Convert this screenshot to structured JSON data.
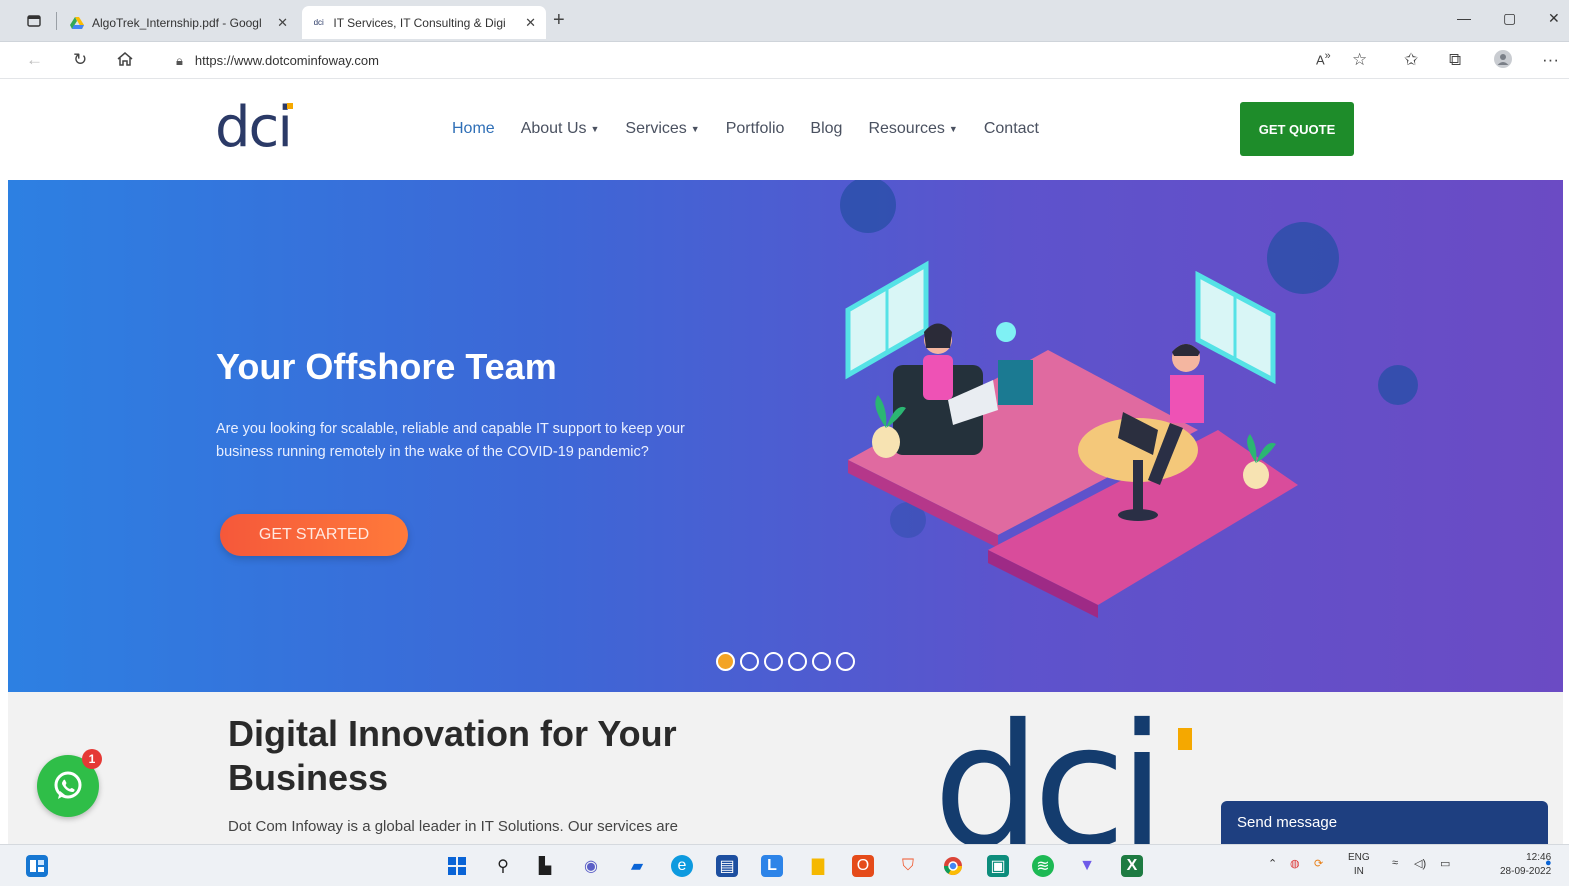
{
  "browser": {
    "tabs": [
      {
        "title": "AlgoTrek_Internship.pdf - Googl",
        "active": false
      },
      {
        "title": "IT Services, IT Consulting & Digi",
        "active": true
      }
    ],
    "url": "https://www.dotcominfoway.com",
    "new_tab_symbol": "+"
  },
  "site": {
    "logo_text": "dci",
    "nav": [
      {
        "label": "Home",
        "dropdown": false
      },
      {
        "label": "About Us",
        "dropdown": true
      },
      {
        "label": "Services",
        "dropdown": true
      },
      {
        "label": "Portfolio",
        "dropdown": false
      },
      {
        "label": "Blog",
        "dropdown": false
      },
      {
        "label": "Resources",
        "dropdown": true
      },
      {
        "label": "Contact",
        "dropdown": false
      }
    ],
    "quote_button": "GET QUOTE",
    "hero": {
      "title": "Your Offshore Team",
      "description": "Are you looking for scalable, reliable and capable IT support to keep your business running remotely in the wake of the COVID-19 pandemic?",
      "cta": "GET STARTED",
      "slides": 6,
      "active_slide": 1
    },
    "section2": {
      "title": "Digital Innovation for Your Business",
      "text": "Dot Com Infoway is a global leader in IT Solutions. Our services are",
      "logo_text": "dci"
    },
    "whatsapp_badge": "1",
    "send_message": "Send message"
  },
  "taskbar": {
    "lang_top": "ENG",
    "lang_bottom": "IN",
    "time": "12:46",
    "date": "28-09-2022"
  },
  "colors": {
    "accent_green": "#1e8c2a",
    "brand_navy": "#2b3a67",
    "brand_orange": "#f5a800",
    "cta_orange": "#f5583a",
    "hero_start": "#2d80e2",
    "hero_end": "#6b4bc4"
  }
}
